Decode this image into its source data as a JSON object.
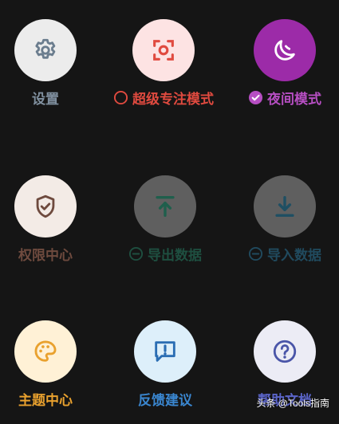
{
  "tiles": {
    "settings": {
      "label": "设置",
      "icon": "gear-icon",
      "circle_color": "#ececec",
      "icon_color": "#6b7d8e",
      "label_color": "#7f8f9e"
    },
    "focus": {
      "label": "超级专注模式",
      "icon": "focus-frame-icon",
      "circle_color": "#fde3e3",
      "icon_color": "#e04a3f",
      "label_color": "#e04a3f"
    },
    "night": {
      "label": "夜间模式",
      "icon": "moon-icon",
      "circle_color": "#9c2ba8",
      "icon_color": "#ffffff",
      "label_color": "#b64ec2"
    },
    "permission": {
      "label": "权限中心",
      "icon": "shield-check-icon",
      "circle_color": "#f3ebe6",
      "icon_color": "#6e4a3e",
      "label_color": "#6e4a3e"
    },
    "export": {
      "label": "导出数据",
      "icon": "upload-icon",
      "circle_color": "#5f5f5f",
      "icon_color": "#1f5f4c",
      "label_color": "#1e4f40"
    },
    "import": {
      "label": "导入数据",
      "icon": "download-icon",
      "circle_color": "#5f5f5f",
      "icon_color": "#1f4f63",
      "label_color": "#204a5e"
    },
    "theme": {
      "label": "主题中心",
      "icon": "palette-icon",
      "circle_color": "#fff1d6",
      "icon_color": "#e9a12e",
      "label_color": "#e9a12e"
    },
    "feedback": {
      "label": "反馈建议",
      "icon": "chat-alert-icon",
      "circle_color": "#ddeffa",
      "icon_color": "#2a6db3",
      "label_color": "#3a86cf"
    },
    "help": {
      "label": "帮助文档",
      "icon": "help-circle-icon",
      "circle_color": "#ececf5",
      "icon_color": "#4a55a8",
      "label_color": "#5a64c8"
    }
  },
  "watermark": {
    "text": "头条 @Tools指南"
  }
}
